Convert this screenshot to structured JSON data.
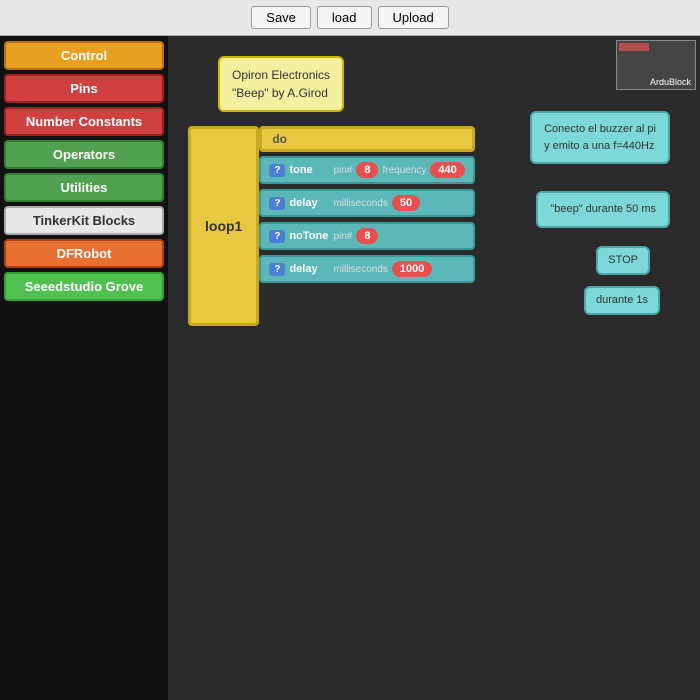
{
  "toolbar": {
    "save_label": "Save",
    "load_label": "load",
    "upload_label": "Upload"
  },
  "sidebar": {
    "items": [
      {
        "id": "control",
        "label": "Control",
        "color": "#e8a020",
        "border": "#b87010"
      },
      {
        "id": "pins",
        "label": "Pins",
        "color": "#d04040",
        "border": "#a02020"
      },
      {
        "id": "number-constants",
        "label": "Number Constants",
        "color": "#d04040",
        "border": "#a02020"
      },
      {
        "id": "operators",
        "label": "Operators",
        "color": "#50a050",
        "border": "#308030"
      },
      {
        "id": "utilities",
        "label": "Utilities",
        "color": "#50a050",
        "border": "#308030"
      },
      {
        "id": "tinkerkit",
        "label": "TinkerKit Blocks",
        "color": "#e8e8e8",
        "border": "#aaaaaa",
        "dark_text": true
      },
      {
        "id": "dfrobot",
        "label": "DFRobot",
        "color": "#e87030",
        "border": "#b04010"
      },
      {
        "id": "seeedstudio",
        "label": "Seeedstudio Grove",
        "color": "#50c050",
        "border": "#30a030"
      }
    ]
  },
  "canvas": {
    "comment1": {
      "line1": "Opiron Electronics",
      "line2": "\"Beep\" by A.Girod"
    },
    "comment2": {
      "text": "Conecto el buzzer al pi\ny emito a una f=440Hz"
    },
    "comment3": {
      "text": "\"beep\" durante 50 ms"
    },
    "comment4": {
      "text": "STOP"
    },
    "comment5": {
      "text": "durante 1s"
    },
    "loop_label": "loop1",
    "do_label": "do",
    "instructions": [
      {
        "qmark": "?",
        "name": "tone",
        "params": [
          {
            "label": "pin#",
            "value": "8",
            "value_color": "red"
          },
          {
            "label": "frequency",
            "value": "440",
            "value_color": "red"
          }
        ]
      },
      {
        "qmark": "?",
        "name": "delay",
        "params": [
          {
            "label": "milliseconds",
            "value": "50",
            "value_color": "red"
          }
        ]
      },
      {
        "qmark": "?",
        "name": "noTone",
        "params": [
          {
            "label": "pin#",
            "value": "8",
            "value_color": "red"
          }
        ]
      },
      {
        "qmark": "?",
        "name": "delay",
        "params": [
          {
            "label": "milliseconds",
            "value": "1000",
            "value_color": "red"
          }
        ]
      }
    ]
  }
}
